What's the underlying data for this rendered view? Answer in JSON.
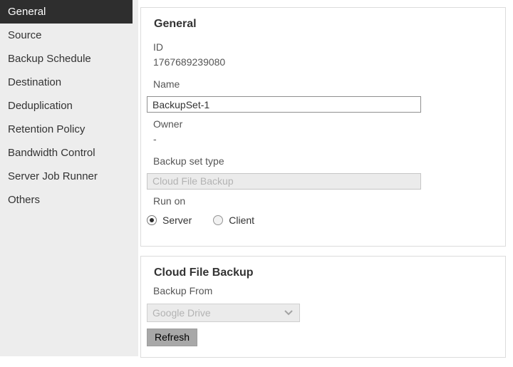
{
  "sidebar": {
    "items": [
      {
        "label": "General",
        "selected": true
      },
      {
        "label": "Source",
        "selected": false
      },
      {
        "label": "Backup Schedule",
        "selected": false
      },
      {
        "label": "Destination",
        "selected": false
      },
      {
        "label": "Deduplication",
        "selected": false
      },
      {
        "label": "Retention Policy",
        "selected": false
      },
      {
        "label": "Bandwidth Control",
        "selected": false
      },
      {
        "label": "Server Job Runner",
        "selected": false
      },
      {
        "label": "Others",
        "selected": false
      }
    ]
  },
  "general_panel": {
    "title": "General",
    "id_label": "ID",
    "id_value": "1767689239080",
    "name_label": "Name",
    "name_value": "BackupSet-1",
    "owner_label": "Owner",
    "owner_value": "-",
    "backup_set_type_label": "Backup set type",
    "backup_set_type_value": "Cloud File Backup",
    "backup_set_type_disabled": true,
    "run_on_label": "Run on",
    "run_on_options": [
      {
        "label": "Server",
        "selected": true
      },
      {
        "label": "Client",
        "selected": false
      }
    ]
  },
  "cloud_panel": {
    "title": "Cloud File Backup",
    "backup_from_label": "Backup From",
    "backup_from_value": "Google Drive",
    "backup_from_disabled": true,
    "refresh_button": "Refresh"
  },
  "colors": {
    "sidebar_bg": "#ededed",
    "sidebar_selected_bg": "#2e2e2e",
    "sidebar_selected_text": "#ffffff",
    "panel_border": "#dcdcdc",
    "disabled_field_bg": "#ebebeb",
    "disabled_field_text": "#b3b3b3",
    "button_bg": "#a8a8a8",
    "radio_dot": "#2e2e2e"
  }
}
